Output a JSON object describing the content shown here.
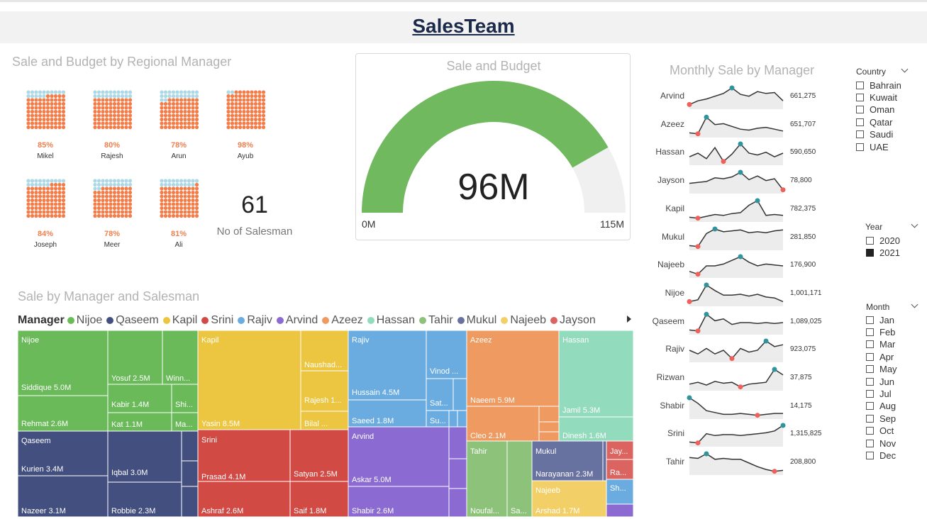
{
  "title": "SalesTeam",
  "waffle": {
    "title": "Sale and Budget by Regional Manager",
    "colors": {
      "filled": "#f47c48",
      "empty": "#add8e6"
    },
    "managers": [
      {
        "name": "Mikel",
        "pct_label": "85%",
        "pct": 85
      },
      {
        "name": "Rajesh",
        "pct_label": "80%",
        "pct": 80
      },
      {
        "name": "Arun",
        "pct_label": "78%",
        "pct": 78
      },
      {
        "name": "Ayub",
        "pct_label": "98%",
        "pct": 98
      },
      {
        "name": "Joseph",
        "pct_label": "84%",
        "pct": 84
      },
      {
        "name": "Meer",
        "pct_label": "78%",
        "pct": 78
      },
      {
        "name": "Ali",
        "pct_label": "81%",
        "pct": 81
      }
    ]
  },
  "salesman": {
    "count": "61",
    "label": "No of Salesman"
  },
  "gauge": {
    "title": "Sale and Budget",
    "value_label": "96M",
    "min_label": "0M",
    "max_label": "115M",
    "value": 96,
    "max": 115,
    "colors": {
      "fill": "#70b95e",
      "track": "#f0f0f0"
    }
  },
  "treemap": {
    "title": "Sale by Manager and Salesman",
    "legend_title": "Manager",
    "legend": [
      {
        "name": "Nijoe",
        "color": "#6aba5a"
      },
      {
        "name": "Qaseem",
        "color": "#43507f"
      },
      {
        "name": "Kapil",
        "color": "#ecc640"
      },
      {
        "name": "Srini",
        "color": "#d24a44"
      },
      {
        "name": "Rajiv",
        "color": "#6aace0"
      },
      {
        "name": "Arvind",
        "color": "#8b6bd2"
      },
      {
        "name": "Azeez",
        "color": "#ee9a60"
      },
      {
        "name": "Hassan",
        "color": "#93dbbd"
      },
      {
        "name": "Tahir",
        "color": "#8cc27a"
      },
      {
        "name": "Mukul",
        "color": "#6872a0"
      },
      {
        "name": "Najeeb",
        "color": "#f2cf67"
      },
      {
        "name": "Jayson",
        "color": "#dc6460"
      }
    ],
    "labels": {
      "nijoe": "Nijoe",
      "siddique": "Siddique 5.0M",
      "rehmat": "Rehmat 2.6M",
      "yosuf": "Yosuf 2.5M",
      "winn": "Winn...",
      "kabir": "Kabir 1.4M",
      "shi": "Shi...",
      "kat": "Kat 1.1M",
      "ma": "Ma...",
      "qaseem": "Qaseem",
      "kurien": "Kurien 3.4M",
      "nazeer": "Nazeer 3.1M",
      "iqbal": "Iqbal 3.0M",
      "robbie": "Robbie 2.3M",
      "kapil": "Kapil",
      "naushad": "Naushad...",
      "rajesh1": "Rajesh 1...",
      "bilal": "Bilal ...",
      "yasin": "Yasin 8.5M",
      "srini": "Srini",
      "prasad": "Prasad 4.1M",
      "ashraf": "Ashraf 2.6M",
      "satyan": "Satyan 2.5M",
      "saif": "Saif 1.8M",
      "rajiv": "Rajiv",
      "hussain": "Hussain 4.5M",
      "saeed": "Saeed 1.8M",
      "vinod": "Vinod ...",
      "sat": "Sat...",
      "su": "Su...",
      "arvind": "Arvind",
      "askar": "Askar 5.0M",
      "shabir": "Shabir 2.6M",
      "azeez": "Azeez",
      "naeem": "Naeem 5.9M",
      "cleo": "Cleo 2.1M",
      "hassan": "Hassan",
      "jamil": "Jamil 5.3M",
      "dinesh": "Dinesh 1.6M",
      "tahir": "Tahir",
      "noufal": "Noufal...",
      "sa": "Sa...",
      "mukul": "Mukul",
      "narayanan": "Narayanan 2.3M",
      "najeeb": "Najeeb",
      "arshad": "Arshad 1.7M",
      "jay": "Jay...",
      "ra": "Ra...",
      "sh": "Sh..."
    }
  },
  "monthly": {
    "title": "Monthly Sale by Manager",
    "colors": {
      "line": "#333333",
      "area": "#ececec",
      "high": "#31939c",
      "low": "#f0605a"
    },
    "rows": [
      {
        "name": "Arvind",
        "value": "661,275",
        "series": [
          0.1,
          0.3,
          0.4,
          0.55,
          0.7,
          1.0,
          0.65,
          0.55,
          0.8,
          0.7,
          0.75,
          0.3
        ]
      },
      {
        "name": "Azeez",
        "value": "651,707",
        "series": [
          0.1,
          0.05,
          0.95,
          0.55,
          0.6,
          0.45,
          0.3,
          0.25,
          0.35,
          0.4,
          0.3,
          0.2
        ]
      },
      {
        "name": "Hassan",
        "value": "590,650",
        "series": [
          0.3,
          0.5,
          0.2,
          0.8,
          0.05,
          0.45,
          1.0,
          0.5,
          0.4,
          0.55,
          0.3,
          0.5
        ]
      },
      {
        "name": "Jayson",
        "value": "78,800",
        "series": [
          0.4,
          0.45,
          0.5,
          0.7,
          0.65,
          0.75,
          1.0,
          0.6,
          0.8,
          0.55,
          0.65,
          0.05
        ]
      },
      {
        "name": "Kapil",
        "value": "782,375",
        "series": [
          0.1,
          0.05,
          0.15,
          0.25,
          0.2,
          0.3,
          0.35,
          0.75,
          1.0,
          0.2,
          0.25,
          0.2
        ]
      },
      {
        "name": "Mukul",
        "value": "281,850",
        "series": [
          0.1,
          0.05,
          0.75,
          1.0,
          0.85,
          0.9,
          0.95,
          0.8,
          0.85,
          0.8,
          0.9,
          0.95
        ]
      },
      {
        "name": "Najeeb",
        "value": "176,900",
        "series": [
          0.2,
          0.05,
          0.5,
          0.5,
          0.6,
          0.8,
          1.0,
          0.7,
          0.5,
          0.6,
          0.55,
          0.5
        ]
      },
      {
        "name": "Nijoe",
        "value": "1,001,171",
        "series": [
          0.1,
          0.2,
          1.0,
          0.7,
          0.45,
          0.45,
          0.5,
          0.4,
          0.5,
          0.35,
          0.3,
          0.1
        ]
      },
      {
        "name": "Qaseem",
        "value": "1,089,025",
        "series": [
          0.1,
          0.05,
          0.95,
          0.6,
          0.7,
          0.4,
          0.5,
          0.5,
          0.45,
          0.5,
          0.45,
          0.5
        ]
      },
      {
        "name": "Rajiv",
        "value": "923,075",
        "series": [
          0.5,
          0.3,
          0.6,
          0.3,
          0.5,
          0.05,
          0.6,
          0.4,
          0.5,
          1.0,
          0.7,
          0.8
        ]
      },
      {
        "name": "Rizwan",
        "value": "37,875",
        "series": [
          0.2,
          0.3,
          0.15,
          0.35,
          0.25,
          0.3,
          0.05,
          0.2,
          0.25,
          0.3,
          1.0,
          0.7
        ]
      },
      {
        "name": "Shabir",
        "value": "14,175",
        "series": [
          1.0,
          0.7,
          0.3,
          0.2,
          0.1,
          0.1,
          0.15,
          0.1,
          0.05,
          0.1,
          0.15,
          0.15
        ]
      },
      {
        "name": "Srini",
        "value": "1,315,825",
        "series": [
          0.1,
          0.05,
          0.55,
          0.45,
          0.5,
          0.5,
          0.45,
          0.5,
          0.55,
          0.6,
          0.7,
          1.0
        ]
      },
      {
        "name": "Tahir",
        "value": "208,800",
        "series": [
          0.8,
          0.75,
          1.0,
          0.7,
          0.75,
          0.7,
          0.7,
          0.5,
          0.3,
          0.15,
          0.05,
          0.1
        ]
      }
    ]
  },
  "slicers": {
    "country": {
      "title": "Country",
      "options": [
        {
          "label": "Bahrain",
          "checked": false
        },
        {
          "label": "Kuwait",
          "checked": false
        },
        {
          "label": "Oman",
          "checked": false
        },
        {
          "label": "Qatar",
          "checked": false
        },
        {
          "label": "Saudi",
          "checked": false
        },
        {
          "label": "UAE",
          "checked": false
        }
      ]
    },
    "year": {
      "title": "Year",
      "options": [
        {
          "label": "2020",
          "checked": false
        },
        {
          "label": "2021",
          "checked": true
        }
      ]
    },
    "month": {
      "title": "Month",
      "options": [
        {
          "label": "Jan",
          "checked": false
        },
        {
          "label": "Feb",
          "checked": false
        },
        {
          "label": "Mar",
          "checked": false
        },
        {
          "label": "Apr",
          "checked": false
        },
        {
          "label": "May",
          "checked": false
        },
        {
          "label": "Jun",
          "checked": false
        },
        {
          "label": "Jul",
          "checked": false
        },
        {
          "label": "Aug",
          "checked": false
        },
        {
          "label": "Sep",
          "checked": false
        },
        {
          "label": "Oct",
          "checked": false
        },
        {
          "label": "Nov",
          "checked": false
        },
        {
          "label": "Dec",
          "checked": false
        }
      ]
    }
  }
}
